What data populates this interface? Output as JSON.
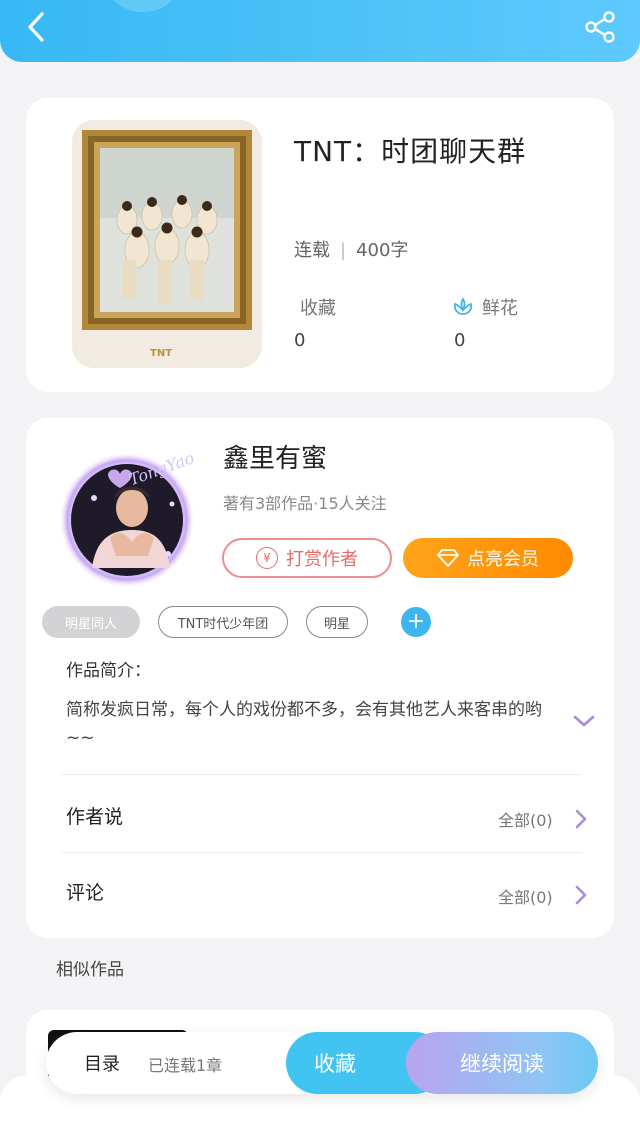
{
  "book": {
    "title": "TNT：时团聊天群",
    "status": "连载",
    "word_count": "400字",
    "favorites_label": "收藏",
    "favorites_count": "0",
    "flowers_label": "鲜花",
    "flowers_count": "0",
    "cover_logo_text": "TNT"
  },
  "author": {
    "name": "鑫里有蜜",
    "meta": "著有3部作品·15人关注",
    "reward_label": "打赏作者",
    "reward_coin": "¥",
    "vip_label": "点亮会员",
    "avatar_overlay_text": "TongYao"
  },
  "tags": [
    "明星同人",
    "TNT时代少年团",
    "明星"
  ],
  "intro": {
    "label": "作品简介：",
    "text": "简称发疯日常，每个人的戏份都不多，会有其他艺人来客串的哟~~"
  },
  "author_says": {
    "label": "作者说",
    "count_text": "全部(0)"
  },
  "comments": {
    "label": "评论",
    "count_text": "全部(0)"
  },
  "similar_title": "相似作品",
  "bottom_bar": {
    "toc_label": "目录",
    "toc_status": "已连载1章",
    "favorite_label": "收藏",
    "read_label": "继续阅读"
  },
  "colors": {
    "header_blue": "#37b8f5",
    "accent_orange": "#ff8a00",
    "reward_red": "#e86a6a",
    "tag_blue": "#3db6f0"
  }
}
